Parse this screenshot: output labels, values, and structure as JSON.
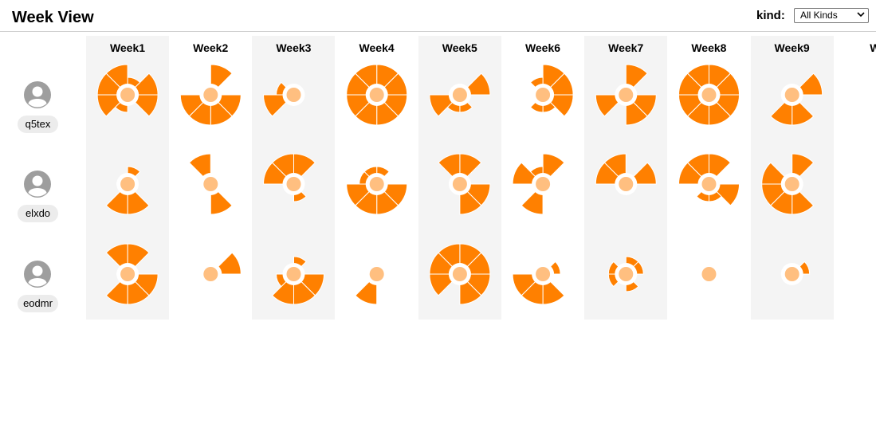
{
  "header": {
    "title": "Week View",
    "kind_label": "kind:",
    "kind_value": "All Kinds"
  },
  "weeks": [
    "Week1",
    "Week2",
    "Week3",
    "Week4",
    "Week5",
    "Week6",
    "Week7",
    "Week8",
    "Week9",
    "W"
  ],
  "users": [
    "q5tex",
    "elxdo",
    "eodmr"
  ],
  "colors": {
    "sector": "#ff8000",
    "center": "#ffbf80",
    "ring": "#ffffff",
    "shade": "#f4f4f4"
  },
  "cells": [
    [
      [
        1,
        2,
        2,
        0,
        1,
        2,
        2,
        2
      ],
      [
        2,
        0,
        2,
        2,
        2,
        2,
        0,
        0
      ],
      [
        0,
        0,
        0,
        0,
        0,
        2,
        1,
        0
      ],
      [
        2,
        2,
        2,
        2,
        2,
        2,
        2,
        2
      ],
      [
        0,
        2,
        0,
        1,
        1,
        2,
        0,
        0
      ],
      [
        2,
        2,
        2,
        1,
        1,
        0,
        0,
        1
      ],
      [
        2,
        0,
        2,
        2,
        0,
        2,
        0,
        0
      ],
      [
        2,
        2,
        2,
        2,
        2,
        2,
        2,
        2
      ],
      [
        0,
        2,
        0,
        2,
        2,
        0,
        0,
        0
      ],
      [
        0,
        0,
        0,
        0,
        0,
        0,
        0,
        0
      ]
    ],
    [
      [
        1,
        0,
        0,
        2,
        2,
        0,
        0,
        0
      ],
      [
        0,
        0,
        0,
        2,
        0,
        0,
        0,
        2
      ],
      [
        2,
        0,
        0,
        1,
        0,
        0,
        2,
        2
      ],
      [
        1,
        0,
        2,
        2,
        2,
        2,
        1,
        1
      ],
      [
        2,
        0,
        2,
        2,
        0,
        0,
        0,
        2
      ],
      [
        2,
        0,
        0,
        0,
        2,
        0,
        2,
        1
      ],
      [
        0,
        2,
        0,
        0,
        0,
        0,
        2,
        2
      ],
      [
        2,
        0,
        2,
        1,
        1,
        0,
        2,
        2
      ],
      [
        2,
        0,
        0,
        2,
        2,
        2,
        2,
        0
      ],
      [
        0,
        0,
        0,
        0,
        0,
        0,
        0,
        0
      ]
    ],
    [
      [
        2,
        0,
        2,
        2,
        2,
        0,
        0,
        2
      ],
      [
        0,
        2,
        0,
        0,
        0,
        0,
        0,
        0
      ],
      [
        1,
        0,
        2,
        2,
        2,
        1,
        0,
        0
      ],
      [
        0,
        0,
        0,
        0,
        2,
        0,
        0,
        0
      ],
      [
        2,
        2,
        2,
        2,
        0,
        2,
        2,
        2
      ],
      [
        0,
        1,
        0,
        2,
        2,
        2,
        0,
        0
      ],
      [
        1,
        1,
        0,
        1,
        0,
        1,
        1,
        0
      ],
      [
        0,
        0,
        0,
        0,
        0,
        0,
        0,
        0
      ],
      [
        0,
        1,
        0,
        0,
        0,
        0,
        0,
        0
      ],
      [
        0,
        0,
        0,
        0,
        0,
        0,
        0,
        0
      ]
    ]
  ]
}
